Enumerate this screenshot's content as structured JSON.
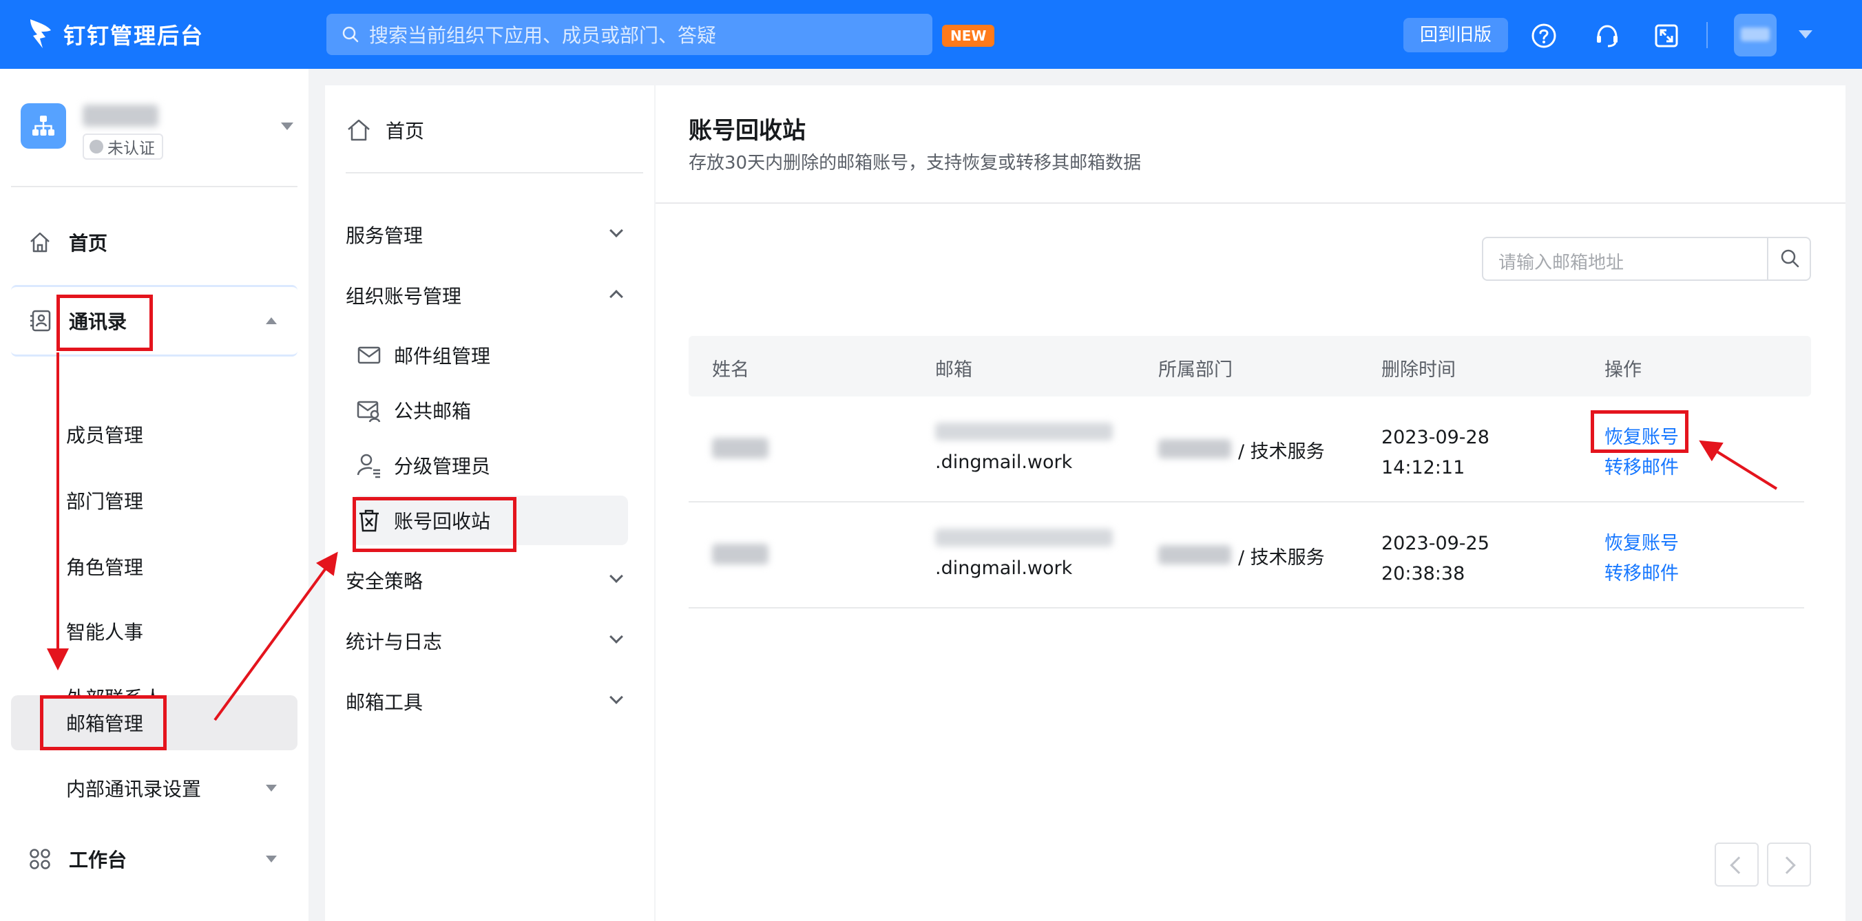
{
  "topbar": {
    "brand_title": "钉钉管理后台",
    "search_placeholder": "搜索当前组织下应用、成员或部门、答疑",
    "new_badge": "NEW",
    "old_version_button": "回到旧版"
  },
  "sidebar": {
    "org_cert": "未认证",
    "home": "首页",
    "contacts": "通讯录",
    "sub_items": [
      "成员管理",
      "部门管理",
      "角色管理",
      "智能人事",
      "外部联系人",
      "邮箱管理",
      "内部通讯录设置"
    ],
    "workbench": "工作台"
  },
  "menu": {
    "home": "首页",
    "service_mgmt": "服务管理",
    "org_account_mgmt": "组织账号管理",
    "sub_items": [
      "邮件组管理",
      "公共邮箱",
      "分级管理员",
      "账号回收站"
    ],
    "security": "安全策略",
    "stats_logs": "统计与日志",
    "mail_tools": "邮箱工具"
  },
  "main": {
    "title": "账号回收站",
    "subtitle": "存放30天内删除的邮箱账号，支持恢复或转移其邮箱数据",
    "search_placeholder": "请输入邮箱地址",
    "columns": [
      "姓名",
      "邮箱",
      "所属部门",
      "删除时间",
      "操作"
    ],
    "rows": [
      {
        "mail_domain": ".dingmail.work",
        "dept": "/ 技术服务",
        "date": "2023-09-28",
        "time": "14:12:11",
        "restore": "恢复账号",
        "transfer": "转移邮件"
      },
      {
        "mail_domain": ".dingmail.work",
        "dept": "/ 技术服务",
        "date": "2023-09-25",
        "time": "20:38:38",
        "restore": "恢复账号",
        "transfer": "转移邮件"
      }
    ]
  },
  "colors": {
    "brand_blue": "#1677ff",
    "highlight_red": "#e4141d",
    "new_orange": "#ff7a1a"
  }
}
